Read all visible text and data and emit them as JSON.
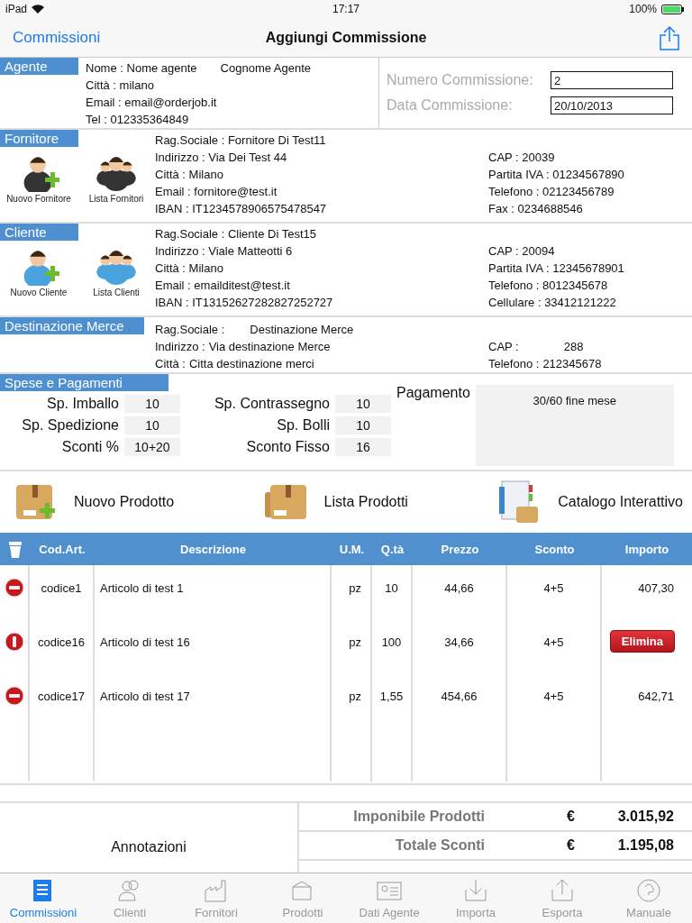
{
  "status_bar": {
    "device": "iPad",
    "time": "17:17",
    "battery": "100%"
  },
  "nav": {
    "back": "Commissioni",
    "title": "Aggiungi Commissione"
  },
  "agent": {
    "header": "Agente",
    "name": "Nome : Nome agente",
    "surname": "Cognome Agente",
    "lines": [
      "Città : milano",
      "Email : email@orderjob.it",
      "Tel : 012335364849"
    ],
    "fields": [
      {
        "label": "Numero Commissione:",
        "value": "2"
      },
      {
        "label": "Data Commissione:",
        "value": "20/10/2013"
      }
    ]
  },
  "parties": [
    {
      "header": "Fornitore",
      "kind": "supplier",
      "actions": [
        {
          "label": "Nuovo Fornitore",
          "kind": "new"
        },
        {
          "label": "Lista Fornitori",
          "kind": "list"
        }
      ],
      "left": [
        "Rag.Sociale : Fornitore Di Test11",
        "Indirizzo : Via Dei Test 44",
        "Città : Milano",
        "Email : fornitore@test.it",
        "IBAN : IT1234578906575478547"
      ],
      "right": [
        "CAP : 20039",
        "Partita IVA : 01234567890",
        "Telefono : 02123456789",
        "Fax : 0234688546"
      ]
    },
    {
      "header": "Cliente",
      "kind": "client",
      "actions": [
        {
          "label": "Nuovo Cliente",
          "kind": "new"
        },
        {
          "label": "Lista Clienti",
          "kind": "list"
        }
      ],
      "left": [
        "Rag.Sociale : Cliente Di Test15",
        "Indirizzo : Viale Matteotti 6",
        "Città : Milano",
        "Email : emailditest@test.it",
        "IBAN : IT13152627282827252727"
      ],
      "right": [
        "CAP : 20094",
        "Partita IVA : 12345678901",
        "Telefono : 8012345678",
        "Cellulare : 33412121222"
      ]
    }
  ],
  "destination": {
    "header": "Destinazione Merce",
    "left": [
      {
        "label": "Rag.Sociale :",
        "value": "Destinazione Merce"
      },
      {
        "label": "Indirizzo :",
        "value": "Via destinazione Merce"
      },
      {
        "label": "Città :",
        "value": "Citta destinazione merci"
      }
    ],
    "right": [
      {
        "label": "CAP :",
        "value": "288"
      },
      {
        "label": "Telefono :",
        "value": "212345678"
      }
    ]
  },
  "expenses": {
    "header": "Spese e Pagamenti",
    "items": [
      {
        "label": "Sp. Imballo",
        "value": "10"
      },
      {
        "label": "Sp. Contrassegno",
        "value": "10"
      },
      {
        "label": "Sp. Spedizione",
        "value": "10"
      },
      {
        "label": "Sp. Bolli",
        "value": "10"
      },
      {
        "label": "Sconti %",
        "value": "10+20"
      },
      {
        "label": "Sconto Fisso",
        "value": "16"
      }
    ],
    "payment_label": "Pagamento",
    "payment": "30/60 fine mese"
  },
  "product_actions": [
    {
      "label": "Nuovo Prodotto",
      "kind": "new"
    },
    {
      "label": "Lista Prodotti",
      "kind": "list"
    },
    {
      "label": "Catalogo Interattivo",
      "kind": "catalog"
    }
  ],
  "table": {
    "columns": [
      "Cod.Art.",
      "Descrizione",
      "U.M.",
      "Q.tà",
      "Prezzo",
      "Sconto",
      "Importo"
    ],
    "rows": [
      {
        "code": "codice1",
        "description": "Articolo di test 1",
        "unit": "pz",
        "qty": "10",
        "price": "44,66",
        "discount": "4+5",
        "amount": "407,30",
        "confirm_delete": false
      },
      {
        "code": "codice16",
        "description": "Articolo di test 16",
        "unit": "pz",
        "qty": "100",
        "price": "34,66",
        "discount": "4+5",
        "delete_label": "Elimina",
        "confirm_delete": true
      },
      {
        "code": "codice17",
        "description": "Articolo di test 17",
        "unit": "pz",
        "qty": "1,55",
        "price": "454,66",
        "discount": "4+5",
        "amount": "642,71",
        "confirm_delete": false
      }
    ]
  },
  "notes": "Annotazioni",
  "totals": [
    {
      "label": "Imponibile Prodotti",
      "currency": "€",
      "value": "3.015,92"
    },
    {
      "label": "Totale Sconti",
      "currency": "€",
      "value": "1.195,08"
    }
  ],
  "tab_bar": [
    {
      "label": "Commissioni",
      "kind": "orders",
      "selected": true
    },
    {
      "label": "Clienti",
      "kind": "clients",
      "selected": false
    },
    {
      "label": "Fornitori",
      "kind": "factory",
      "selected": false
    },
    {
      "label": "Prodotti",
      "kind": "box",
      "selected": false
    },
    {
      "label": "Dati Agente",
      "kind": "card",
      "selected": false
    },
    {
      "label": "Importa",
      "kind": "import",
      "selected": false
    },
    {
      "label": "Esporta",
      "kind": "export",
      "selected": false
    },
    {
      "label": "Manuale",
      "kind": "help",
      "selected": false
    }
  ]
}
